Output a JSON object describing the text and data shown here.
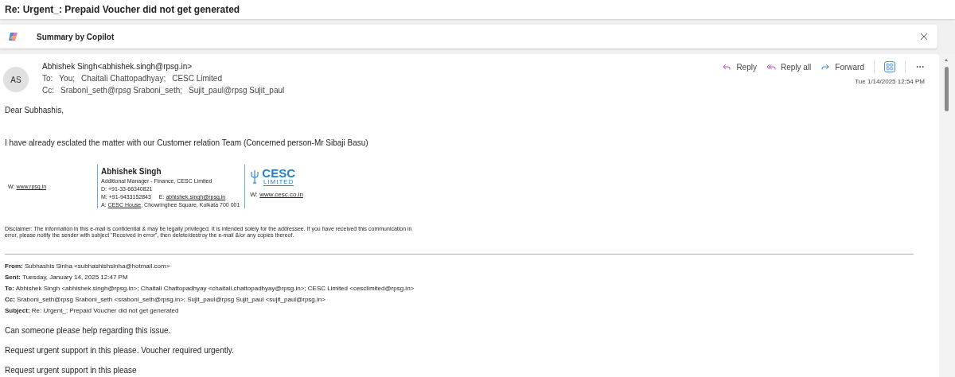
{
  "subject": "Re: Urgent_: Prepaid Voucher did not get generated",
  "copilot": {
    "label": "Summary by Copilot"
  },
  "message": {
    "avatar": "AS",
    "from": "Abhishek Singh<abhishek.singh@rpsg.in>",
    "to": {
      "label": "To:",
      "recipients": [
        "You;",
        "Chaitali Chattopadhyay;",
        "CESC Limited"
      ]
    },
    "cc": {
      "label": "Cc:",
      "recipients": [
        "Sraboni_seth@rpsg Sraboni_seth;",
        "Sujit_paul@rpsg Sujit_paul"
      ]
    },
    "actions": [
      {
        "kind": "reply",
        "label": "Reply"
      },
      {
        "kind": "reply_all",
        "label": "Reply all"
      },
      {
        "kind": "forward",
        "label": "Forward"
      },
      {
        "kind": "apps"
      },
      {
        "kind": "more"
      }
    ],
    "date": "Tue 1/14/2025 12:54 PM"
  },
  "body": {
    "greeting": "Dear Subhashis,",
    "paragraph": "I have already esclated the matter with our Customer relation Team (Concerned person-Mr Sibaji Basu)",
    "signature": {
      "left_website": {
        "label": "W:",
        "link": "www.rpsg.in"
      },
      "name": "Abhishek Singh",
      "title": "Additional Manager - Finance, CESC Limited",
      "phone": "D: +91-33-66340821",
      "mobile": "M: +91-9433152843",
      "email": {
        "label": "E:",
        "link": "abhishek.singh@rpsg.in"
      },
      "address": {
        "label": "A:",
        "link": "CESC House",
        "rest": ", Chowringhee Square, Kolkata 700 001"
      },
      "logo": {
        "name": "CESC",
        "tagline": "LIMITED"
      },
      "right_website": {
        "label": "W:",
        "link": "www.cesc.co.in"
      }
    },
    "disclaimer": "Disclaimer: The information in this e-mail is confidential & may be legally privileged. It is intended solely for the addressee. If you have received this communication in error, please notify the sender with subject \"Received in error\", then delete/destroy the e-mail &/or any copies thereof.",
    "quoted": {
      "headers": [
        "**From:** Subhashis Sinha <subhashishsinha@hotmail.com>",
        "**Sent:** Tuesday, January 14, 2025 12:47 PM",
        "**To:** Abhishek Singh <abhishek.singh@rpsg.in>; Chaitali Chattopadhyay <chaitali.chattopadhyay@rpsg.in>; CESC Limited <cesclimited@rpsg.in>",
        "**Cc:** Sraboni_seth@rpsg Sraboni_seth <sraboni_seth@rpsg.in>; Sujit_paul@rpsg Sujit_paul <sujit_paul@rpsg.in>",
        "**Subject:** Re: Urgent_: Prepaid Voucher did not get generated"
      ],
      "paragraphs": [
        "Can someone please help regarding this issue.",
        "Request urgent support in this please. Voucher required urgently.",
        "Request urgent support in this please"
      ]
    }
  }
}
